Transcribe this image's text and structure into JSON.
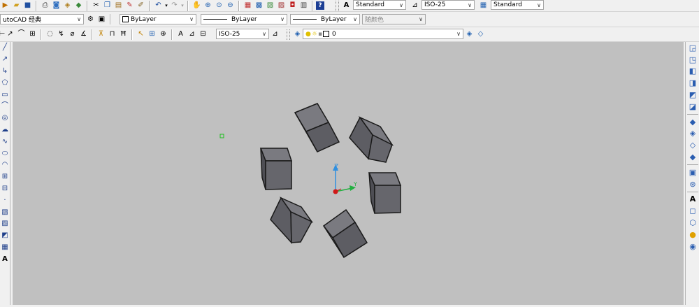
{
  "toolbar_standard": {
    "icons": [
      "new-icon",
      "open-icon",
      "save-icon",
      "print-icon",
      "preview-icon",
      "publish-icon",
      "3d-print-icon",
      "cut-icon",
      "copy-icon",
      "paste-icon",
      "match-properties-icon",
      "block-editor-icon",
      "undo-icon",
      "redo-icon",
      "pan-icon",
      "zoom-realtime-icon",
      "zoom-window-icon",
      "zoom-previous-icon",
      "properties-icon",
      "design-center-icon",
      "tool-palettes-icon",
      "sheet-set-icon",
      "markup-icon",
      "calculator-icon",
      "help-icon"
    ]
  },
  "styles": {
    "text_style": "Standard",
    "dim_style": "ISO-25",
    "table_style": "Standard"
  },
  "workspace": {
    "value": "utoCAD 经典"
  },
  "properties": {
    "color": "ByLayer",
    "linetype": "ByLayer",
    "lineweight": "ByLayer",
    "plotstyle": "随颜色"
  },
  "dimension_toolbar": {
    "dim_style": "ISO-25"
  },
  "layers": {
    "current_layer": "0"
  },
  "left_draw_icons": [
    "line-icon",
    "construction-line-icon",
    "polyline-icon",
    "polygon-icon",
    "rectangle-icon",
    "arc-icon",
    "circle-icon",
    "revision-cloud-icon",
    "spline-icon",
    "ellipse-icon",
    "ellipse-arc-icon",
    "insert-block-icon",
    "make-block-icon",
    "point-icon",
    "hatch-icon",
    "gradient-icon",
    "region-icon",
    "table-icon",
    "multiline-text-icon"
  ],
  "right_modeling_icons": [
    "view-top-icon",
    "view-bottom-icon",
    "view-left-icon",
    "view-right-icon",
    "view-front-icon",
    "view-back-icon",
    "iso-sw-icon",
    "iso-se-icon",
    "iso-ne-icon",
    "iso-nw-icon",
    "camera-icon",
    "orbit-icon",
    "text-style-icon",
    "box-icon",
    "wedge-icon",
    "visual-style-icon",
    "layer-icon"
  ],
  "colors": {
    "viewport_bg": "#c0c0c0",
    "cube_face": "#6a6a70",
    "axis_x": "#e02020",
    "axis_y": "#22b040",
    "axis_z": "#3090e0"
  },
  "ucs": {
    "z_label": "Z",
    "y_label": "Y"
  }
}
